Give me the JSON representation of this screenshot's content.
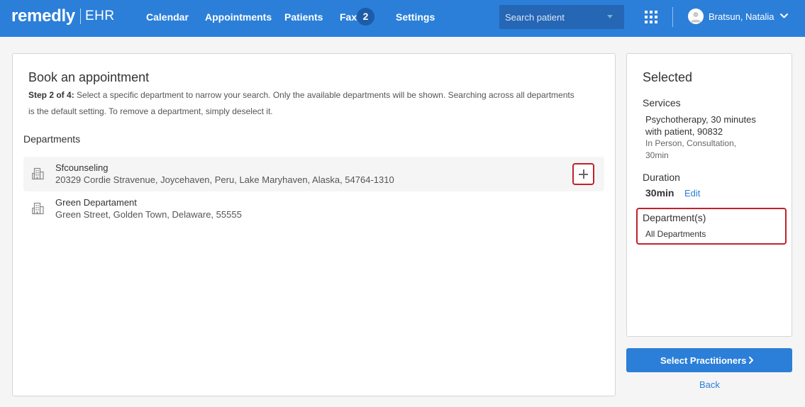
{
  "brand": {
    "name": "remedly",
    "product": "EHR"
  },
  "nav": {
    "items": [
      {
        "label": "Calendar"
      },
      {
        "label": "Appointments"
      },
      {
        "label": "Patients"
      },
      {
        "label": "Fax"
      },
      {
        "label": "Settings"
      }
    ],
    "fax_count": "2",
    "search_placeholder": "Search patient",
    "user_name": "Bratsun, Natalia"
  },
  "booking": {
    "title": "Book an appointment",
    "step_label": "Step 2 of 4:",
    "step_text": "Select a specific department to narrow your search. Only the available departments will be shown. Searching across all departments is the default setting. To remove a department, simply deselect it.",
    "departments_heading": "Departments",
    "departments": [
      {
        "name": "Sfcounseling",
        "address": "20329 Cordie Stravenue, Joycehaven, Peru, Lake Maryhaven, Alaska, 54764-1310"
      },
      {
        "name": "Green Departament",
        "address": "Green Street, Golden Town, Delaware, 55555"
      }
    ]
  },
  "selected": {
    "title": "Selected",
    "services_label": "Services",
    "service_name": "Psychotherapy, 30 minutes with patient, 90832",
    "service_detail": "In Person, Consultation, 30min",
    "duration_label": "Duration",
    "duration_value": "30min",
    "edit_label": "Edit",
    "department_label": "Department(s)",
    "department_value": "All Departments"
  },
  "actions": {
    "primary_label": "Select Practitioners",
    "back_label": "Back"
  },
  "colors": {
    "brand_blue": "#2b7fd8",
    "highlight_red": "#c0222b"
  },
  "icons": [
    "grid-icon",
    "user-avatar-icon",
    "chevron-down-icon",
    "building-icon",
    "plus-icon",
    "chevron-right-icon"
  ]
}
